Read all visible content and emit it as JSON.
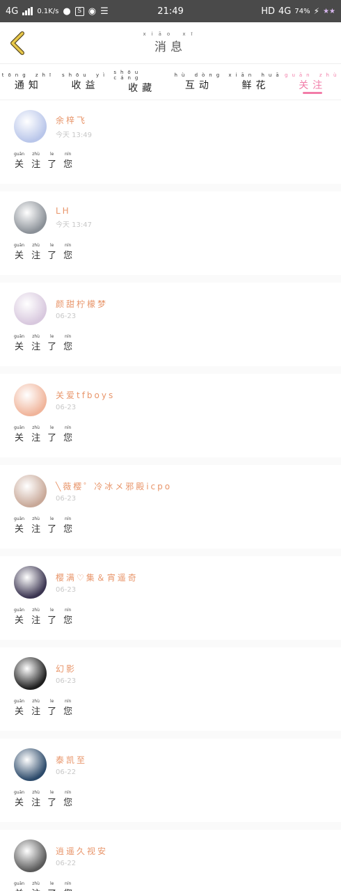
{
  "status_bar": {
    "network": "4G",
    "speed": "0.1K/s",
    "time": "21:49",
    "hd": "HD",
    "network_right": "4G",
    "battery": "74%"
  },
  "header": {
    "title": "消息",
    "title_pinyin": "xiāo xī"
  },
  "tabs": [
    {
      "label": "通知",
      "pinyin": "tōng zhī"
    },
    {
      "label": "收益",
      "pinyin": "shōu yì"
    },
    {
      "label": "收藏",
      "pinyin": "shōu cáng"
    },
    {
      "label": "互动",
      "pinyin": "hù dòng"
    },
    {
      "label": "鲜花",
      "pinyin": "xiān huā"
    },
    {
      "label": "关注",
      "pinyin": "guān zhù"
    }
  ],
  "message_text": {
    "chars": [
      "关",
      "注",
      "了",
      "您"
    ],
    "pinyin": [
      "guān",
      "zhù",
      "le",
      "nín"
    ]
  },
  "items": [
    {
      "name": "余梓飞",
      "time": "今天 13:49",
      "avatar_color": "#b9c6ea"
    },
    {
      "name": "LH",
      "time": "今天 13:47",
      "avatar_color": "#8a9097"
    },
    {
      "name": "颜甜柠檬梦",
      "time": "06-23",
      "avatar_color": "#d8c8de"
    },
    {
      "name": "关爱tfboys",
      "time": "06-23",
      "avatar_color": "#f0b49a"
    },
    {
      "name": "╲薇樱゜冷冰メ邪殿icpo",
      "time": "06-23",
      "avatar_color": "#c8a898"
    },
    {
      "name": "樱满♡集＆宵遥奇",
      "time": "06-23",
      "avatar_color": "#3a3450"
    },
    {
      "name": "幻影",
      "time": "06-23",
      "avatar_color": "#1e1e1e"
    },
    {
      "name": "泰凯至",
      "time": "06-22",
      "avatar_color": "#2c4a6a"
    },
    {
      "name": "逍遥久视安",
      "time": "06-22",
      "avatar_color": "#5a5a5a"
    }
  ],
  "colors": {
    "accent": "#f27ca8",
    "name": "#e8956a",
    "status_bar": "#4a4a4a",
    "back_arrow": "#e8c84a"
  }
}
